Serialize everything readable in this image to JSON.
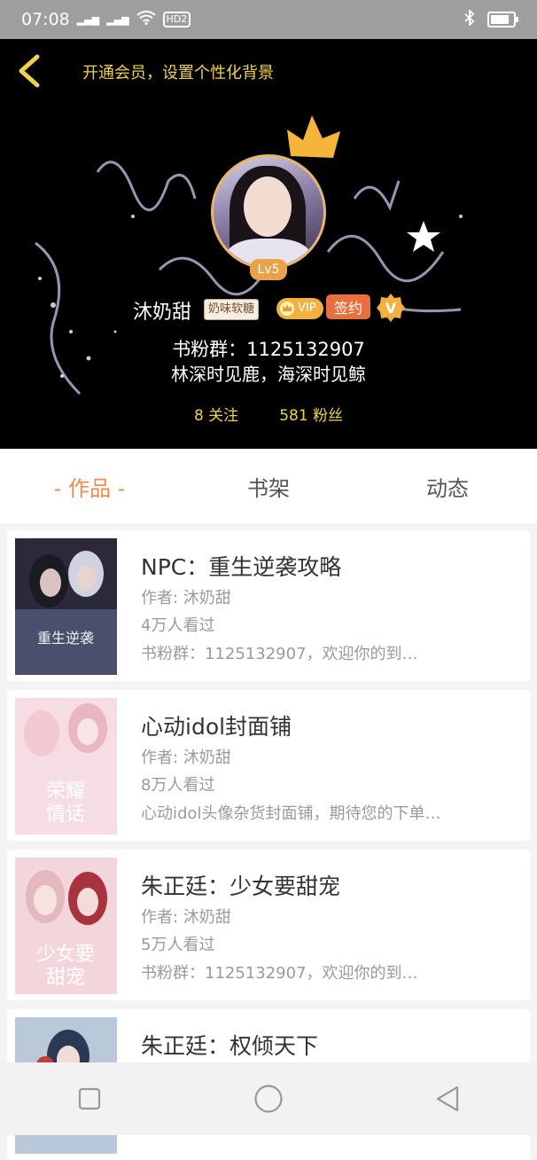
{
  "status_bar": {
    "time": "07:08",
    "network_1": "2G",
    "network_2": "4G",
    "hd_label": "HD2"
  },
  "header": {
    "background_link": "开通会员，设置个性化背景",
    "level": "Lv5",
    "username": "沐奶甜",
    "candy_tag": "奶味软糖",
    "vip_label": "VIP",
    "signed_label": "签约",
    "v_label": "V",
    "fan_group": "书粉群：1125132907",
    "motto": "林深时见鹿，海深时见鲸",
    "following": "8 关注",
    "followers": "581 粉丝",
    "colors": {
      "accent": "#f0d24a",
      "tab_active": "#f08a4e"
    }
  },
  "tabs": [
    {
      "label": "- 作品 -",
      "active": true
    },
    {
      "label": "书架",
      "active": false
    },
    {
      "label": "动态",
      "active": false
    }
  ],
  "books": [
    {
      "title": "NPC：重生逆袭攻略",
      "author": "作者: 沐奶甜",
      "views": "4万人看过",
      "desc": "书粉群：1125132907，欢迎你的到…"
    },
    {
      "title": "心动idol封面铺",
      "author": "作者: 沐奶甜",
      "views": "8万人看过",
      "desc": "心动idol头像杂货封面铺，期待您的下单…"
    },
    {
      "title": "朱正廷：少女要甜宠",
      "author": "作者: 沐奶甜",
      "views": "5万人看过",
      "desc": "书粉群：1125132907，欢迎你的到…"
    },
    {
      "title": "朱正廷：权倾天下",
      "author": "",
      "views": "",
      "desc": ""
    }
  ],
  "icons": {
    "back": "chevron-left-icon",
    "crown": "crown-icon",
    "nav_recent": "square-icon",
    "nav_home": "circle-icon",
    "nav_back": "triangle-back-icon"
  }
}
